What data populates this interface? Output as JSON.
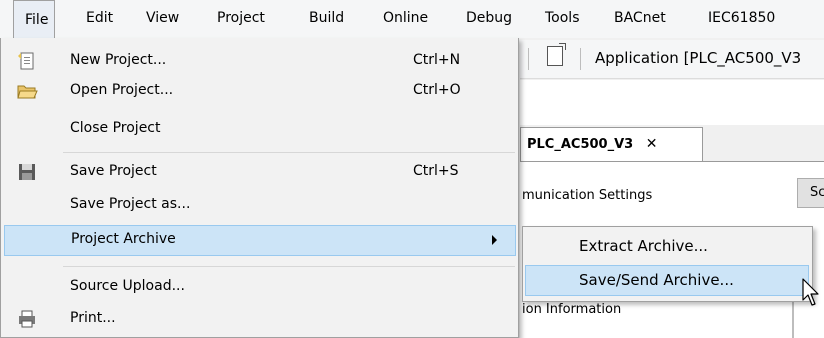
{
  "menubar": {
    "items": [
      {
        "label": "File"
      },
      {
        "label": "Edit"
      },
      {
        "label": "View"
      },
      {
        "label": "Project"
      },
      {
        "label": "Build"
      },
      {
        "label": "Online"
      },
      {
        "label": "Debug"
      },
      {
        "label": "Tools"
      },
      {
        "label": "BACnet"
      },
      {
        "label": "IEC61850"
      }
    ]
  },
  "background": {
    "app_title": "Application [PLC_AC500_V3",
    "tab_label": "PLC_AC500_V3",
    "tab_close": "✕",
    "comm_settings": "munication Settings",
    "scan_button": "Sca",
    "info_text": "ion Information"
  },
  "file_menu": {
    "items": [
      {
        "label": "New Project...",
        "shortcut": "Ctrl+N",
        "icon": "new-project-icon"
      },
      {
        "label": "Open Project...",
        "shortcut": "Ctrl+O",
        "icon": "open-folder-icon"
      },
      {
        "label": "Close Project",
        "shortcut": ""
      },
      {
        "label": "Save Project",
        "shortcut": "Ctrl+S",
        "icon": "save-disk-icon"
      },
      {
        "label": "Save Project as...",
        "shortcut": ""
      },
      {
        "label": "Project Archive",
        "shortcut": "",
        "has_submenu": true,
        "highlighted": true
      },
      {
        "label": "Source Upload...",
        "shortcut": ""
      },
      {
        "label": "Print...",
        "shortcut": "",
        "icon": "printer-icon"
      }
    ]
  },
  "archive_submenu": {
    "items": [
      {
        "label": "Extract Archive..."
      },
      {
        "label": "Save/Send Archive...",
        "highlighted": true
      }
    ]
  },
  "colors": {
    "highlight_bg": "#cce4f7",
    "highlight_border": "#99c9ef",
    "menu_bg": "#f2f2f2"
  }
}
